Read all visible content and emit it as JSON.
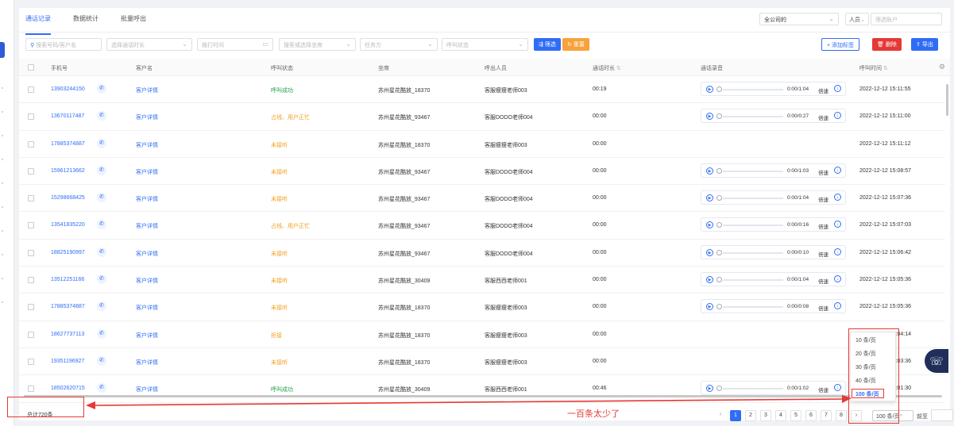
{
  "tabs": [
    {
      "label": "通话记录",
      "active": true
    },
    {
      "label": "数据统计",
      "active": false
    },
    {
      "label": "批量呼出",
      "active": false
    }
  ],
  "top_filters": {
    "company": "全公司的",
    "person": "人员",
    "user_placeholder": "筛选账户"
  },
  "filters": {
    "phone_placeholder": "搜索号码/客户名",
    "duration_placeholder": "选择通话时长",
    "time_placeholder": "拨打时间",
    "seat_placeholder": "搜索或选择坐席",
    "task_placeholder": "任务方",
    "status_placeholder": "呼叫状态",
    "filter_button": "筛选",
    "reset_button": "重置"
  },
  "actions": {
    "add_tag": "+ 添加标签",
    "delete": "删除",
    "export": "导出"
  },
  "columns": [
    "手机号",
    "客户名",
    "呼叫状态",
    "坐席",
    "呼出人员",
    "通话时长",
    "通话录音",
    "呼叫时间"
  ],
  "rows": [
    {
      "phone": "13903244150",
      "customer": "客户详情",
      "status": "呼叫成功",
      "status_type": "ok",
      "seat": "苏州星花酷放_18370",
      "caller": "客服瘦瘦老师003",
      "duration": "00:19",
      "recording": "0:00/1:04",
      "speed": "倍速",
      "time": "2022-12-12 15:11:55"
    },
    {
      "phone": "13670117487",
      "customer": "客户详情",
      "status": "占线、用户正忙",
      "status_type": "warn",
      "seat": "苏州星花酷放_93467",
      "caller": "客服DODO老师004",
      "duration": "00:00",
      "recording": "0:00/0:27",
      "speed": "倍速",
      "time": "2022-12-12 15:11:00"
    },
    {
      "phone": "17885374887",
      "customer": "客户详情",
      "status": "未接听",
      "status_type": "warn",
      "seat": "苏州星花酷放_18370",
      "caller": "客服瘦瘦老师003",
      "duration": "00:00",
      "recording": "",
      "speed": "",
      "time": "2022-12-12 15:11:12"
    },
    {
      "phone": "15961213662",
      "customer": "客户详情",
      "status": "未接听",
      "status_type": "warn",
      "seat": "苏州星花酷放_93467",
      "caller": "客服DODO老师004",
      "duration": "00:00",
      "recording": "0:00/1:03",
      "speed": "倍速",
      "time": "2022-12-12 15:08:57"
    },
    {
      "phone": "15298668425",
      "customer": "客户详情",
      "status": "未接听",
      "status_type": "warn",
      "seat": "苏州星花酷放_93467",
      "caller": "客服DODO老师004",
      "duration": "00:00",
      "recording": "0:00/1:04",
      "speed": "倍速",
      "time": "2022-12-12 15:07:36"
    },
    {
      "phone": "13541835220",
      "customer": "客户详情",
      "status": "占线、用户正忙",
      "status_type": "warn",
      "seat": "苏州星花酷放_93467",
      "caller": "客服DODO老师004",
      "duration": "00:00",
      "recording": "0:00/0:16",
      "speed": "倍速",
      "time": "2022-12-12 15:07:03"
    },
    {
      "phone": "18825190997",
      "customer": "客户详情",
      "status": "未接听",
      "status_type": "warn",
      "seat": "苏州星花酷放_93467",
      "caller": "客服DODO老师004",
      "duration": "00:00",
      "recording": "0:00/0:10",
      "speed": "倍速",
      "time": "2022-12-12 15:06:42"
    },
    {
      "phone": "13512251166",
      "customer": "客户详情",
      "status": "未接听",
      "status_type": "warn",
      "seat": "苏州星花酷放_30409",
      "caller": "客服西西老师001",
      "duration": "00:00",
      "recording": "0:00/1:04",
      "speed": "倍速",
      "time": "2022-12-12 15:05:36"
    },
    {
      "phone": "17885374887",
      "customer": "客户详情",
      "status": "未接听",
      "status_type": "warn",
      "seat": "苏州星花酷放_18370",
      "caller": "客服瘦瘦老师003",
      "duration": "00:00",
      "recording": "0:00/0:08",
      "speed": "倍速",
      "time": "2022-12-12 15:05:36"
    },
    {
      "phone": "18627737113",
      "customer": "客户详情",
      "status": "拒接",
      "status_type": "warn",
      "seat": "苏州星花酷放_18370",
      "caller": "客服瘦瘦老师003",
      "duration": "00:00",
      "recording": "",
      "speed": "",
      "time": "2022-12-12 15:04:14"
    },
    {
      "phone": "19351196927",
      "customer": "客户详情",
      "status": "未接听",
      "status_type": "warn",
      "seat": "苏州星花酷放_18370",
      "caller": "客服瘦瘦老师003",
      "duration": "00:00",
      "recording": "",
      "speed": "",
      "time": "2022-12-12 15:03:36"
    },
    {
      "phone": "18502620715",
      "customer": "客户详情",
      "status": "呼叫成功",
      "status_type": "ok",
      "seat": "苏州星花酷放_30409",
      "caller": "客服西西老师001",
      "duration": "00:46",
      "recording": "0:00/1:02",
      "speed": "倍速",
      "time": "2022-12-12 15:01:30"
    }
  ],
  "footer": {
    "total": "总计720条",
    "pages": [
      "1",
      "2",
      "3",
      "4",
      "5",
      "6",
      "7",
      "8"
    ],
    "current_page": "1",
    "page_size": "100 条/页",
    "goto_label": "前至",
    "page_unit": "页"
  },
  "page_size_options": [
    "10 条/页",
    "20 条/页",
    "30 条/页",
    "40 条/页",
    "100 条/页"
  ],
  "annotation": {
    "text": "一百条太少了"
  },
  "colors": {
    "primary": "#2f6df6",
    "success": "#21a049",
    "warning": "#f0a020",
    "danger": "#e53935"
  }
}
